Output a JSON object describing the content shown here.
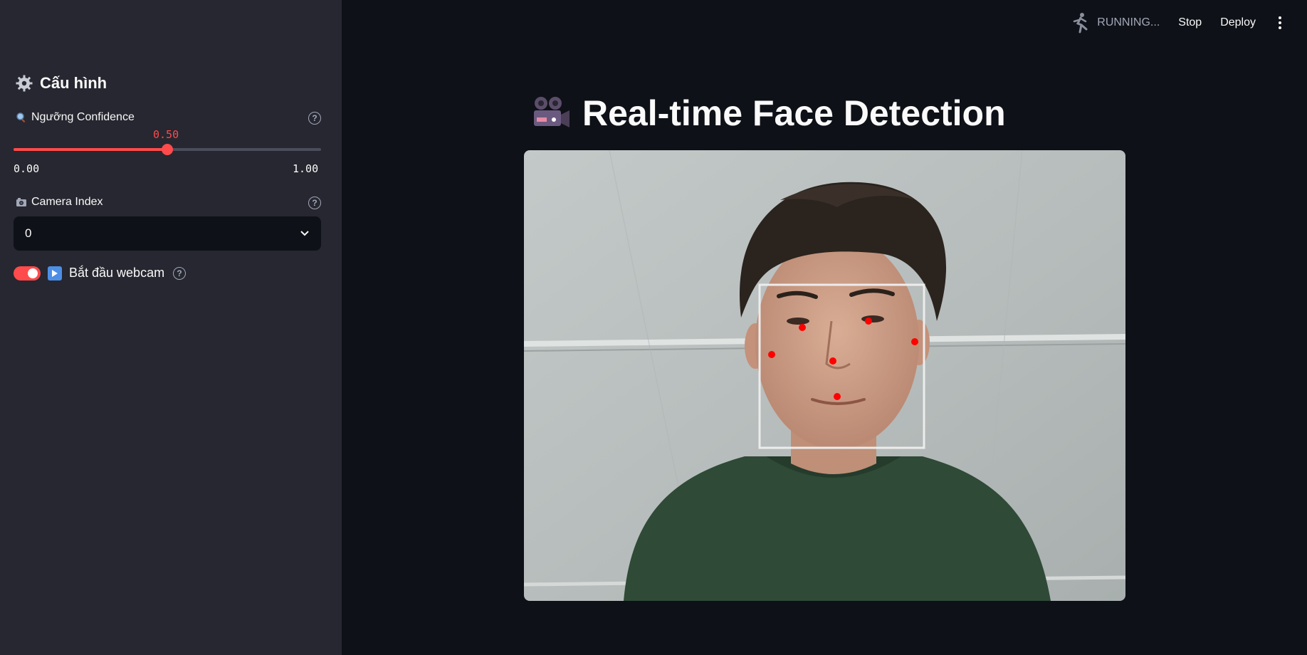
{
  "sidebar": {
    "heading": "Cấu hình",
    "confidence": {
      "label": "Ngưỡng Confidence",
      "value": 0.5,
      "value_text": "0.50",
      "min_text": "0.00",
      "max_text": "1.00"
    },
    "camera": {
      "label": "Camera Index",
      "selected": "0"
    },
    "webcam_toggle": {
      "label": "Bắt đầu webcam",
      "on": true
    }
  },
  "header": {
    "status": "RUNNING...",
    "stop_label": "Stop",
    "deploy_label": "Deploy"
  },
  "main": {
    "title": "Real-time Face Detection"
  },
  "colors": {
    "accent": "#ff4b4b",
    "background": "#0e1117",
    "sidebar": "#262730",
    "landmark": "#ff0000"
  },
  "icons": [
    "gear-icon",
    "magnifier-icon",
    "camera-icon",
    "help-icon",
    "chevron-down-icon",
    "play-icon",
    "running-icon",
    "kebab-menu-icon",
    "movie-camera-icon"
  ]
}
